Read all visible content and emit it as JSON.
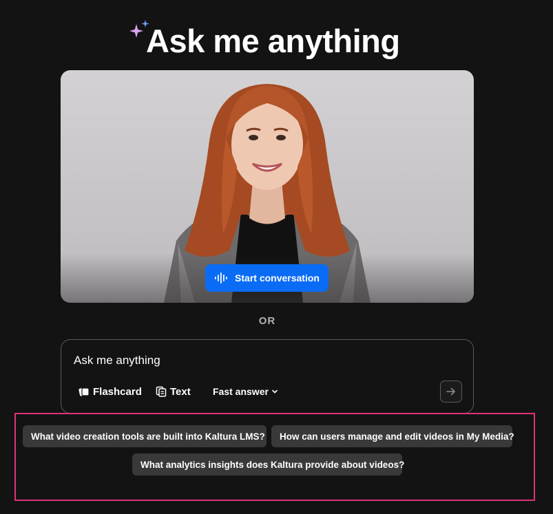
{
  "header": {
    "title": "Ask me anything",
    "sparkle_icon": "sparkle-icon"
  },
  "video": {
    "start_label": "Start conversation",
    "start_icon": "audio-wave-icon"
  },
  "divider": {
    "or_label": "OR"
  },
  "ask_box": {
    "placeholder": "Ask me anything",
    "value": "",
    "tools": [
      {
        "label": "Flashcard",
        "icon": "flashcard-icon"
      },
      {
        "label": "Text",
        "icon": "text-copy-icon"
      },
      {
        "label": "Fast answer",
        "icon": "chevron-down-icon"
      }
    ],
    "send_icon": "arrow-right-icon"
  },
  "suggestions": [
    {
      "label": "What video creation tools are built into Kaltura LMS?"
    },
    {
      "label": "How can users manage and edit videos in My Media?"
    },
    {
      "label": "What analytics insights does Kaltura provide about videos?"
    }
  ],
  "colors": {
    "background": "#141314",
    "accent_blue": "#0a6cf5",
    "highlight_border": "#e0317a",
    "chip_bg": "#3a393a"
  }
}
